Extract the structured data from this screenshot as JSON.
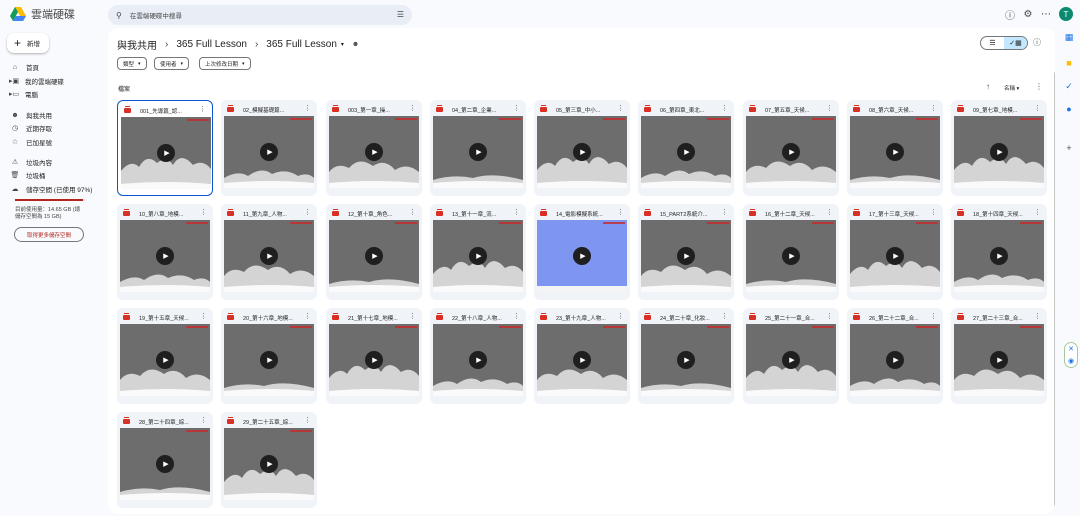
{
  "app": {
    "title": "雲端硬碟",
    "colors": {
      "accent": "#0b57d0",
      "selected": "#c2e7ff",
      "danger": "#b3261e",
      "avatar": "#0b8a6f"
    }
  },
  "search": {
    "placeholder": "在雲端硬碟中搜尋"
  },
  "header": {
    "avatar_letter": "T",
    "icons": [
      "help-icon",
      "settings-icon",
      "apps-icon"
    ]
  },
  "sidebar": {
    "new_label": "新增",
    "items": [
      {
        "label": "首頁",
        "icon": "home-icon"
      },
      {
        "label": "我的雲端硬碟",
        "icon": "drive-icon"
      },
      {
        "label": "電腦",
        "icon": "computer-icon"
      },
      {
        "label": "與我共用",
        "icon": "people-icon"
      },
      {
        "label": "近期存取",
        "icon": "clock-icon"
      },
      {
        "label": "已加星號",
        "icon": "star-icon"
      },
      {
        "label": "垃圾內容",
        "icon": "spam-icon"
      },
      {
        "label": "垃圾桶",
        "icon": "trash-icon"
      },
      {
        "label": "儲存空間 (已使用 97%)",
        "icon": "cloud-icon"
      }
    ],
    "storage": {
      "used_line": "目前使用量：14.65 GB (總",
      "total_line": "儲存空間為 15 GB)",
      "percent_used": 97,
      "get_more": "取得更多儲存空間"
    }
  },
  "breadcrumb": {
    "root": "與我共用",
    "parent": "365 Full Lesson",
    "current": "365 Full Lesson"
  },
  "filters": [
    {
      "label": "類型"
    },
    {
      "label": "使用者"
    },
    {
      "label": "上次修改日期"
    }
  ],
  "section_label": "檔案",
  "sort": {
    "label": "名稱"
  },
  "files": [
    {
      "name": "001_先導篇_認...",
      "selected": true
    },
    {
      "name": "02_模擬基礎篇..."
    },
    {
      "name": "003_第一章_操..."
    },
    {
      "name": "04_第二章_企業..."
    },
    {
      "name": "05_第三章_中小..."
    },
    {
      "name": "06_第四章_東北..."
    },
    {
      "name": "07_第五章_天候..."
    },
    {
      "name": "08_第六章_天候..."
    },
    {
      "name": "09_第七章_地模..."
    },
    {
      "name": "10_第八章_地模..."
    },
    {
      "name": "11_第九章_人物..."
    },
    {
      "name": "12_第十章_角色..."
    },
    {
      "name": "13_第十一章_流..."
    },
    {
      "name": "14_電影模擬系統...",
      "blue": true
    },
    {
      "name": "15_PART2系統介..."
    },
    {
      "name": "16_第十二章_天候..."
    },
    {
      "name": "17_第十三章_天候..."
    },
    {
      "name": "18_第十四章_天候..."
    },
    {
      "name": "19_第十五章_天候..."
    },
    {
      "name": "20_第十六章_地模..."
    },
    {
      "name": "21_第十七章_地模..."
    },
    {
      "name": "22_第十八章_人物..."
    },
    {
      "name": "23_第十九章_人物..."
    },
    {
      "name": "24_第二十章_化妝..."
    },
    {
      "name": "25_第二十一章_合..."
    },
    {
      "name": "26_第二十二章_合..."
    },
    {
      "name": "27_第二十三章_合..."
    },
    {
      "name": "28_第二十四章_綜..."
    },
    {
      "name": "29_第二十五章_綜..."
    }
  ]
}
